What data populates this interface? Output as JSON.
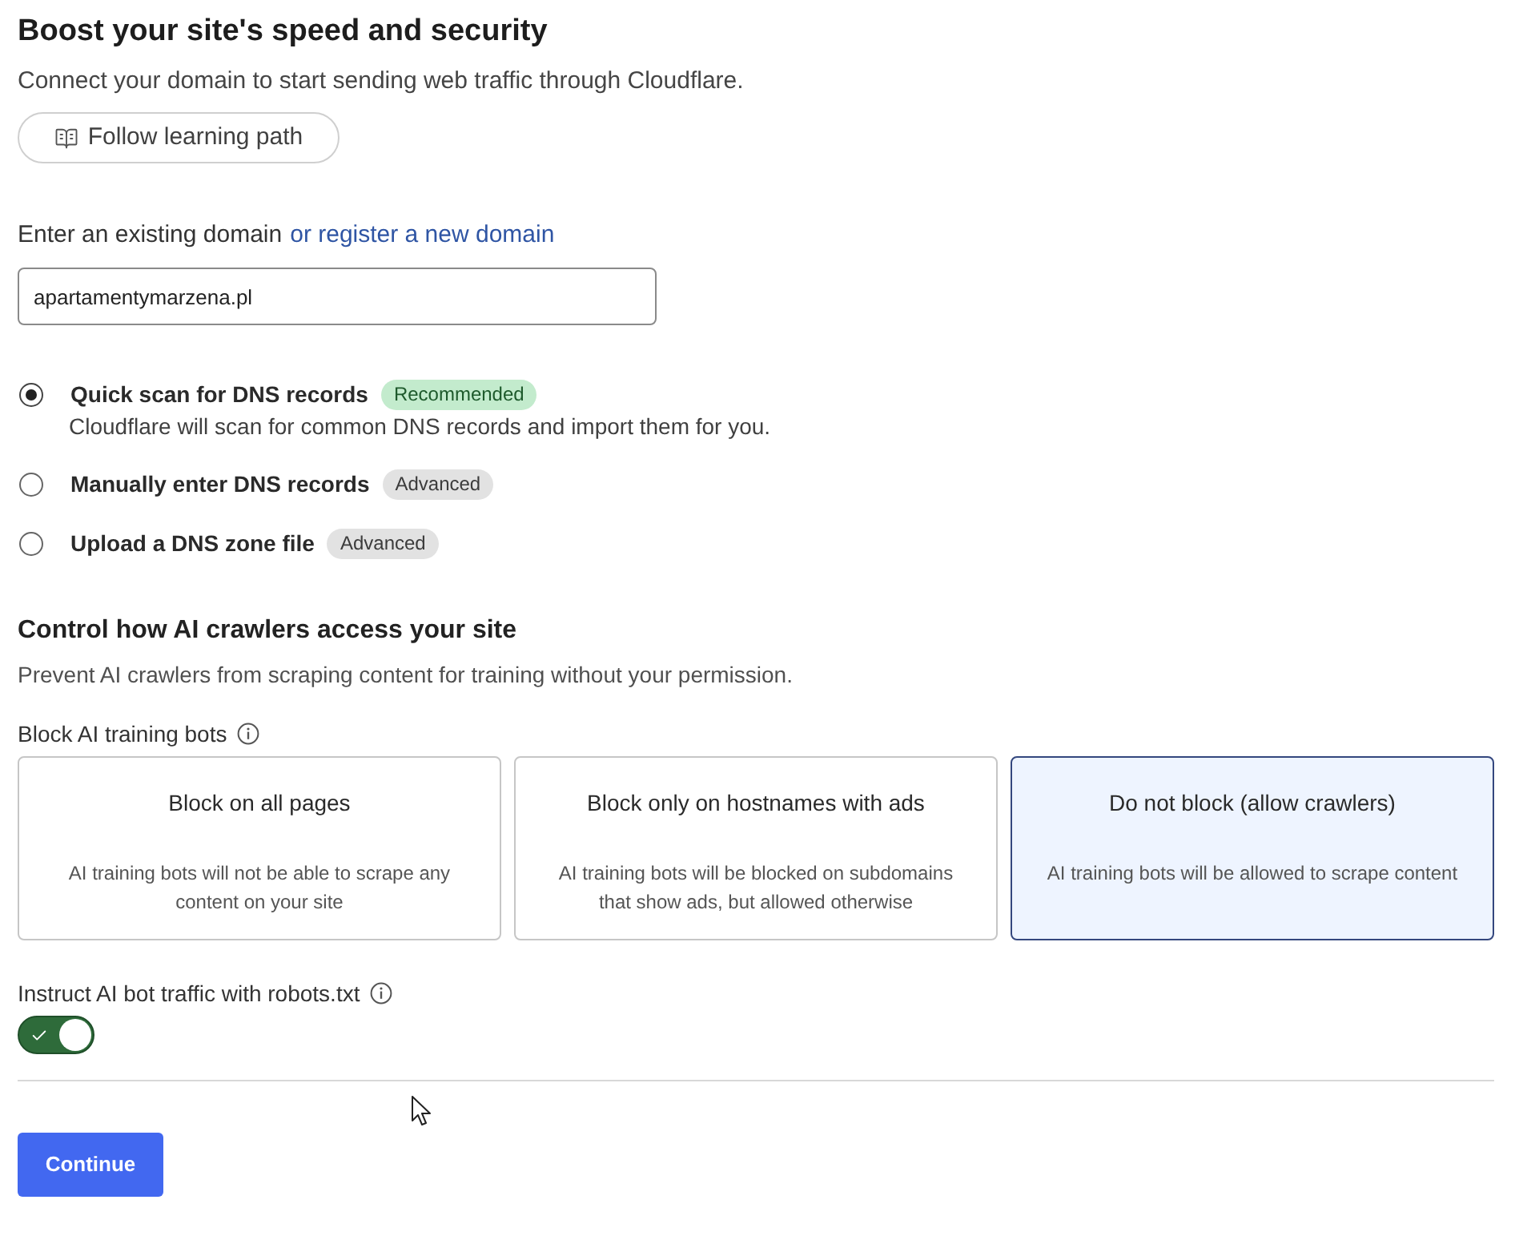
{
  "header": {
    "title": "Boost your site's speed and security",
    "subtitle": "Connect your domain to start sending web traffic through Cloudflare.",
    "learning_button": "Follow learning path"
  },
  "domain": {
    "label": "Enter an existing domain",
    "link": "or register a new domain",
    "value": "apartamentymarzena.pl"
  },
  "scan_options": [
    {
      "label": "Quick scan for DNS records",
      "badge": {
        "text": "Recommended",
        "kind": "recommended"
      },
      "description": "Cloudflare will scan for common DNS records and import them for you.",
      "selected": true
    },
    {
      "label": "Manually enter DNS records",
      "badge": {
        "text": "Advanced",
        "kind": "advanced"
      },
      "selected": false
    },
    {
      "label": "Upload a DNS zone file",
      "badge": {
        "text": "Advanced",
        "kind": "advanced"
      },
      "selected": false
    }
  ],
  "ai_crawlers": {
    "title": "Control how AI crawlers access your site",
    "description": "Prevent AI crawlers from scraping content for training without your permission.",
    "block_label": "Block AI training bots",
    "block_options": [
      {
        "title": "Block on all pages",
        "description": "AI training bots will not be able to scrape any content on your site",
        "selected": false
      },
      {
        "title": "Block only on hostnames with ads",
        "description": "AI training bots will be blocked on subdomains that show ads, but allowed otherwise",
        "selected": false
      },
      {
        "title": "Do not block (allow crawlers)",
        "description": "AI training bots will be allowed to scrape content",
        "selected": true
      }
    ],
    "robots_label": "Instruct AI bot traffic with robots.txt",
    "robots_toggle": {
      "on": true
    }
  },
  "continue_button": "Continue"
}
